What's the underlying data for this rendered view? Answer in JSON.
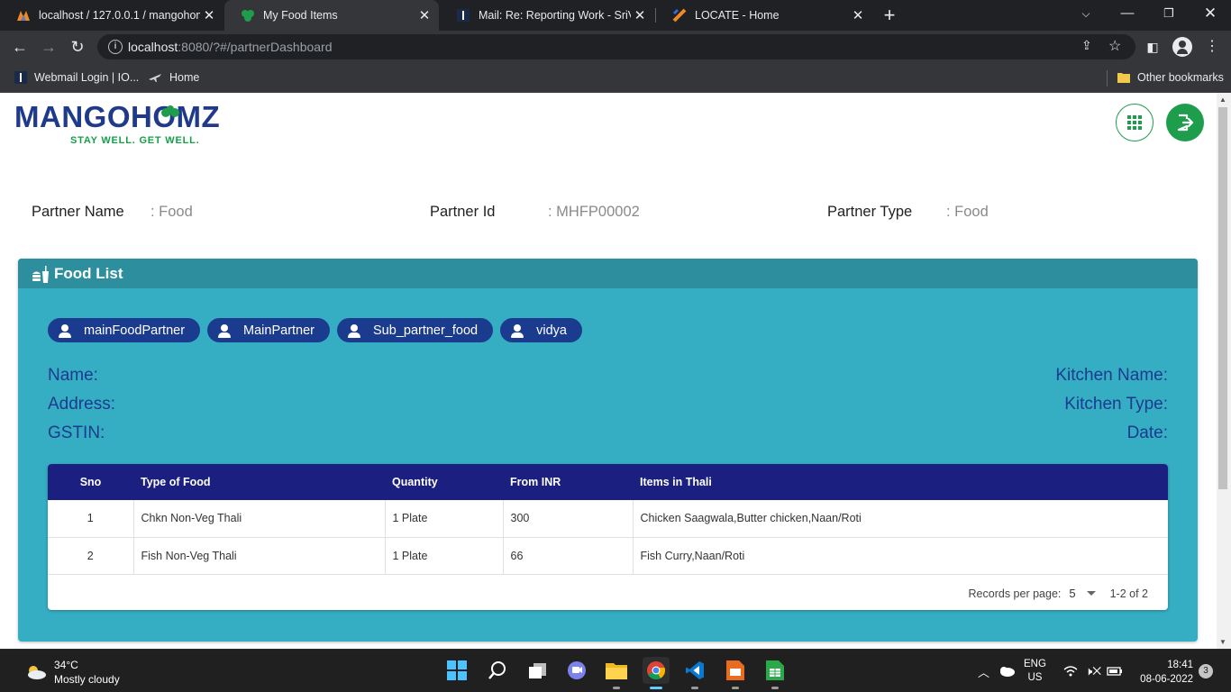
{
  "browser": {
    "tabs": [
      {
        "title": "localhost / 127.0.0.1 / mangohom",
        "favicon": "phpmyadmin-icon",
        "active": false
      },
      {
        "title": "My Food Items",
        "favicon": "mangohomz-leaf-icon",
        "active": true
      },
      {
        "title": "Mail: Re: Reporting Work - SriVid",
        "favicon": "mail-icon",
        "active": false
      },
      {
        "title": "LOCATE - Home",
        "favicon": "locate-icon",
        "active": false
      }
    ],
    "url_host": "localhost",
    "url_rest": ":8080/?#/partnerDashboard",
    "bookmarks": [
      {
        "label": "Webmail Login | IO...",
        "icon": "webmail-icon"
      },
      {
        "label": "Home",
        "icon": "plane-icon"
      }
    ],
    "other_bookmarks": "Other bookmarks"
  },
  "header": {
    "logo_text": "MANGOHOMZ",
    "tagline": "STAY WELL. GET WELL.",
    "brand_color": "#1e9e4c",
    "logo_color": "#1f3a8a"
  },
  "partner": {
    "name_label": "Partner Name",
    "name_value": ": Food",
    "id_label": "Partner Id",
    "id_value": ": MHFP00002",
    "type_label": "Partner Type",
    "type_value": ": Food"
  },
  "food_list": {
    "title": "Food List",
    "card_color": "#35aec3",
    "chips": [
      "mainFoodPartner",
      "MainPartner",
      "Sub_partner_food",
      "vidya"
    ],
    "details_left": [
      "Name:",
      "Address:",
      "GSTIN:"
    ],
    "details_right": [
      "Kitchen Name:",
      "Kitchen Type:",
      "Date:"
    ],
    "table": {
      "headers": [
        "Sno",
        "Type of Food",
        "Quantity",
        "From INR",
        "Items in Thali"
      ],
      "rows": [
        [
          "1",
          "Chkn Non-Veg Thali",
          "1 Plate",
          "300",
          "Chicken Saagwala,Butter chicken,Naan/Roti"
        ],
        [
          "2",
          "Fish Non-Veg Thali",
          "1 Plate",
          "66",
          "Fish Curry,Naan/Roti"
        ]
      ]
    },
    "pager": {
      "label": "Records per page:",
      "per_page": "5",
      "range": "1-2 of 2"
    }
  },
  "taskbar": {
    "temperature": "34°C",
    "weather": "Mostly cloudy",
    "lang_top": "ENG",
    "lang_bottom": "US",
    "time": "18:41",
    "date": "08-06-2022",
    "notifications": "3"
  }
}
